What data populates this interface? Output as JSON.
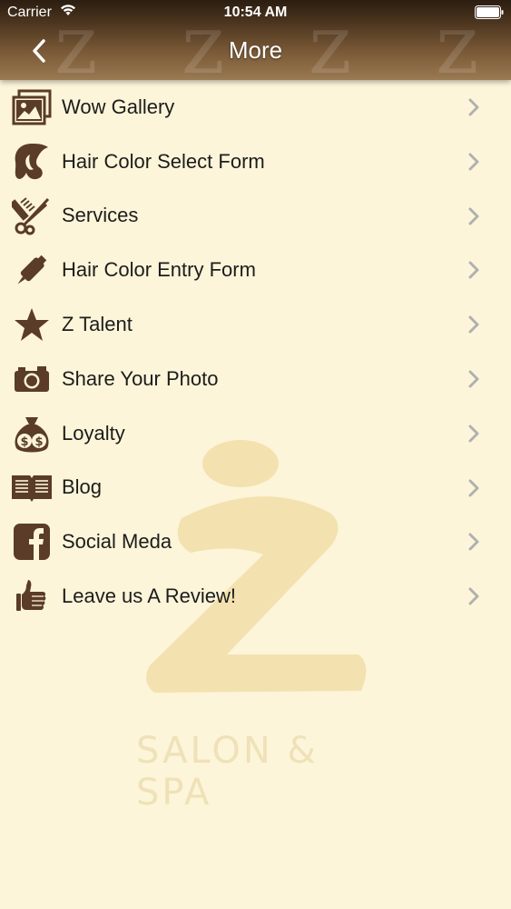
{
  "status_bar": {
    "carrier": "Carrier",
    "time": "10:54 AM",
    "wifi_icon": "wifi-icon",
    "battery_icon": "battery-icon"
  },
  "nav": {
    "title": "More",
    "back_icon": "chevron-left-icon"
  },
  "colors": {
    "header_dark": "#2b1d10",
    "header_light": "#9a7a52",
    "background": "#fdf5d9",
    "icon_brown": "#5a3c28",
    "chevron": "#b0b0b0",
    "watermark": "#f3e2b0"
  },
  "menu": {
    "items": [
      {
        "label": "Wow Gallery",
        "icon": "gallery-icon"
      },
      {
        "label": "Hair Color Select Form",
        "icon": "hair-profile-icon"
      },
      {
        "label": "Services",
        "icon": "scissors-comb-icon"
      },
      {
        "label": "Hair Color Entry Form",
        "icon": "color-bottle-icon"
      },
      {
        "label": "Z Talent",
        "icon": "star-icon"
      },
      {
        "label": "Share Your Photo",
        "icon": "camera-icon"
      },
      {
        "label": "Loyalty",
        "icon": "money-bag-icon"
      },
      {
        "label": "Blog",
        "icon": "open-book-icon"
      },
      {
        "label": "Social Meda",
        "icon": "facebook-icon"
      },
      {
        "label": "Leave us A Review!",
        "icon": "thumbs-up-icon"
      }
    ]
  },
  "watermark": {
    "logo_text": "SALON & SPA"
  }
}
